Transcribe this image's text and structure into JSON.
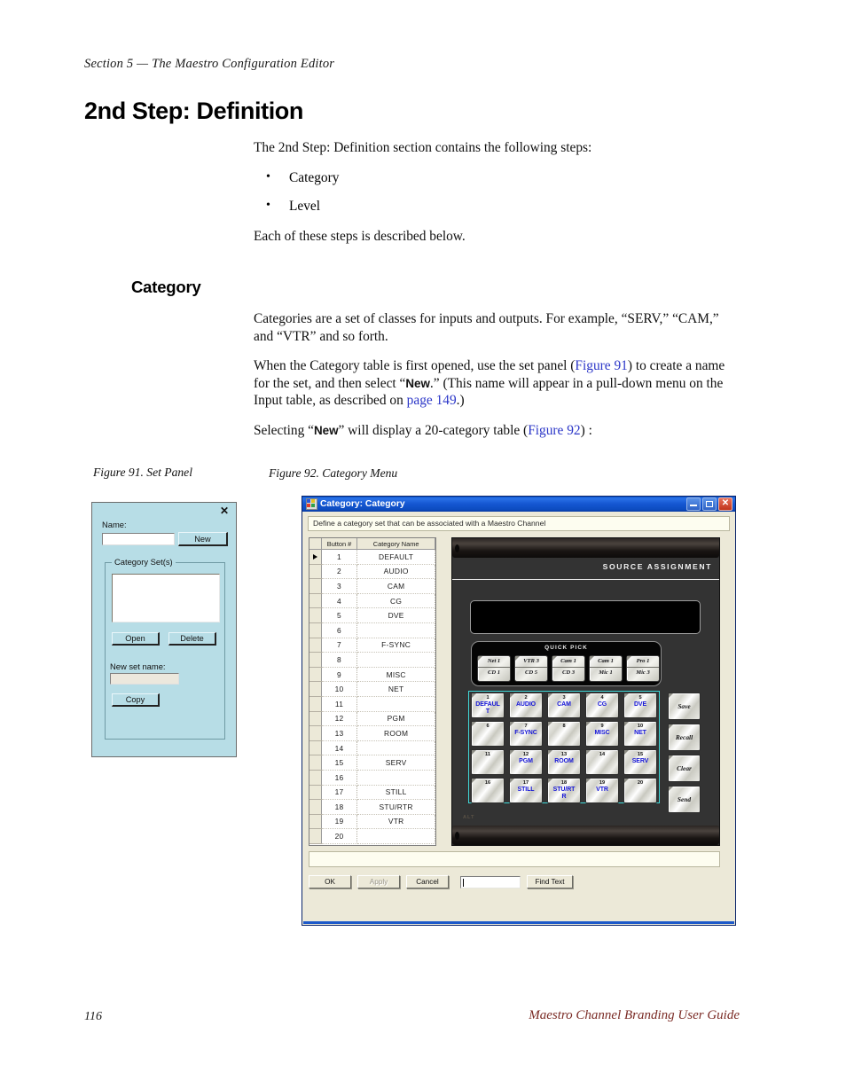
{
  "page": {
    "running_head": "Section 5  —  The Maestro Configuration Editor",
    "chapter_title": "2nd Step: Definition",
    "section_title": "Category",
    "page_number": "116",
    "footer_title": "Maestro Channel Branding User Guide"
  },
  "body": {
    "intro": "The 2nd Step: Definition section contains the following steps:",
    "bullets": [
      "Category",
      "Level"
    ],
    "after_bullets": "Each of these steps is described below.",
    "para1": "Categories are a set of classes for inputs and outputs. For example, “SERV,” “CAM,” and “VTR” and so forth.",
    "para2_a": "When the Category table is first opened, use the set panel (",
    "para2_xref1": "Figure 91",
    "para2_b": ") to create a name for the set, and then select “",
    "para2_ui": "New",
    "para2_c": ".” (This name will appear in a pull-down menu on the Input table, as described on ",
    "para2_xref2": "page 149",
    "para2_d": ".)",
    "para3_a": "Selecting “",
    "para3_ui": "New",
    "para3_b": "” will display a 20-category table (",
    "para3_xref": "Figure 92",
    "para3_c": ") :"
  },
  "figures": {
    "fig91_caption": "Figure 91.  Set Panel",
    "fig92_caption": "Figure 92.  Category Menu"
  },
  "set_panel": {
    "close_glyph": "✕",
    "name_label": "Name:",
    "name_value": "",
    "new_button": "New",
    "group_title": "Category Set(s)",
    "list_items": [],
    "open_button": "Open",
    "delete_button": "Delete",
    "new_set_label": "New set name:",
    "new_set_value": "",
    "copy_button": "Copy"
  },
  "category_window": {
    "title": "Category: Category",
    "minimize_label": "",
    "maximize_label": "",
    "close_label": "✕",
    "banner": "Define a category set that can be associated with a Maestro Channel",
    "table": {
      "headers": [
        "",
        "Button #",
        "Category Name"
      ],
      "rows": [
        {
          "selected": true,
          "button": "1",
          "name": "DEFAULT"
        },
        {
          "selected": false,
          "button": "2",
          "name": "AUDIO"
        },
        {
          "selected": false,
          "button": "3",
          "name": "CAM"
        },
        {
          "selected": false,
          "button": "4",
          "name": "CG"
        },
        {
          "selected": false,
          "button": "5",
          "name": "DVE"
        },
        {
          "selected": false,
          "button": "6",
          "name": ""
        },
        {
          "selected": false,
          "button": "7",
          "name": "F-SYNC"
        },
        {
          "selected": false,
          "button": "8",
          "name": ""
        },
        {
          "selected": false,
          "button": "9",
          "name": "MISC"
        },
        {
          "selected": false,
          "button": "10",
          "name": "NET"
        },
        {
          "selected": false,
          "button": "11",
          "name": ""
        },
        {
          "selected": false,
          "button": "12",
          "name": "PGM"
        },
        {
          "selected": false,
          "button": "13",
          "name": "ROOM"
        },
        {
          "selected": false,
          "button": "14",
          "name": ""
        },
        {
          "selected": false,
          "button": "15",
          "name": "SERV"
        },
        {
          "selected": false,
          "button": "16",
          "name": ""
        },
        {
          "selected": false,
          "button": "17",
          "name": "STILL"
        },
        {
          "selected": false,
          "button": "18",
          "name": "STU/RTR"
        },
        {
          "selected": false,
          "button": "19",
          "name": "VTR"
        },
        {
          "selected": false,
          "button": "20",
          "name": ""
        }
      ]
    },
    "panel": {
      "header_label": "SOURCE ASSIGNMENT",
      "lcd_text": "",
      "quick_pick_title": "QUICK PICK",
      "quick_pick": [
        {
          "top": "Net 1",
          "bottom": "CD 1"
        },
        {
          "top": "VTR 3",
          "bottom": "CD 5"
        },
        {
          "top": "Cam 1",
          "bottom": "CD 3"
        },
        {
          "top": "Cam 1",
          "bottom": "Mic 1"
        },
        {
          "top": "Pro 1",
          "bottom": "Mic 3"
        }
      ],
      "source_buttons": [
        {
          "num": "1",
          "label": "DEFAUL T"
        },
        {
          "num": "2",
          "label": "AUDIO"
        },
        {
          "num": "3",
          "label": "CAM"
        },
        {
          "num": "4",
          "label": "CG"
        },
        {
          "num": "5",
          "label": "DVE"
        },
        {
          "num": "6",
          "label": ""
        },
        {
          "num": "7",
          "label": "F-SYNC"
        },
        {
          "num": "8",
          "label": ""
        },
        {
          "num": "9",
          "label": "MISC"
        },
        {
          "num": "10",
          "label": "NET"
        },
        {
          "num": "11",
          "label": ""
        },
        {
          "num": "12",
          "label": "PGM"
        },
        {
          "num": "13",
          "label": "ROOM"
        },
        {
          "num": "14",
          "label": ""
        },
        {
          "num": "15",
          "label": "SERV"
        },
        {
          "num": "16",
          "label": ""
        },
        {
          "num": "17",
          "label": "STILL"
        },
        {
          "num": "18",
          "label": "STU/RT R"
        },
        {
          "num": "19",
          "label": "VTR"
        },
        {
          "num": "20",
          "label": ""
        }
      ],
      "side_buttons": [
        "Save",
        "Recall",
        "Clear",
        "Send"
      ],
      "alt_text": "ALT"
    },
    "footer_buttons": {
      "ok": "OK",
      "apply": "Apply",
      "cancel": "Cancel",
      "find_value": "",
      "find_text": "Find Text"
    }
  },
  "colors": {
    "xref": "#2b36c8",
    "set_panel_bg": "#b7dde6",
    "titlebar_blue": "#1557d2",
    "button_label_blue": "#1414d8",
    "grid_outline_cyan": "#3fd8d8",
    "footer_title": "#7a2a24"
  }
}
